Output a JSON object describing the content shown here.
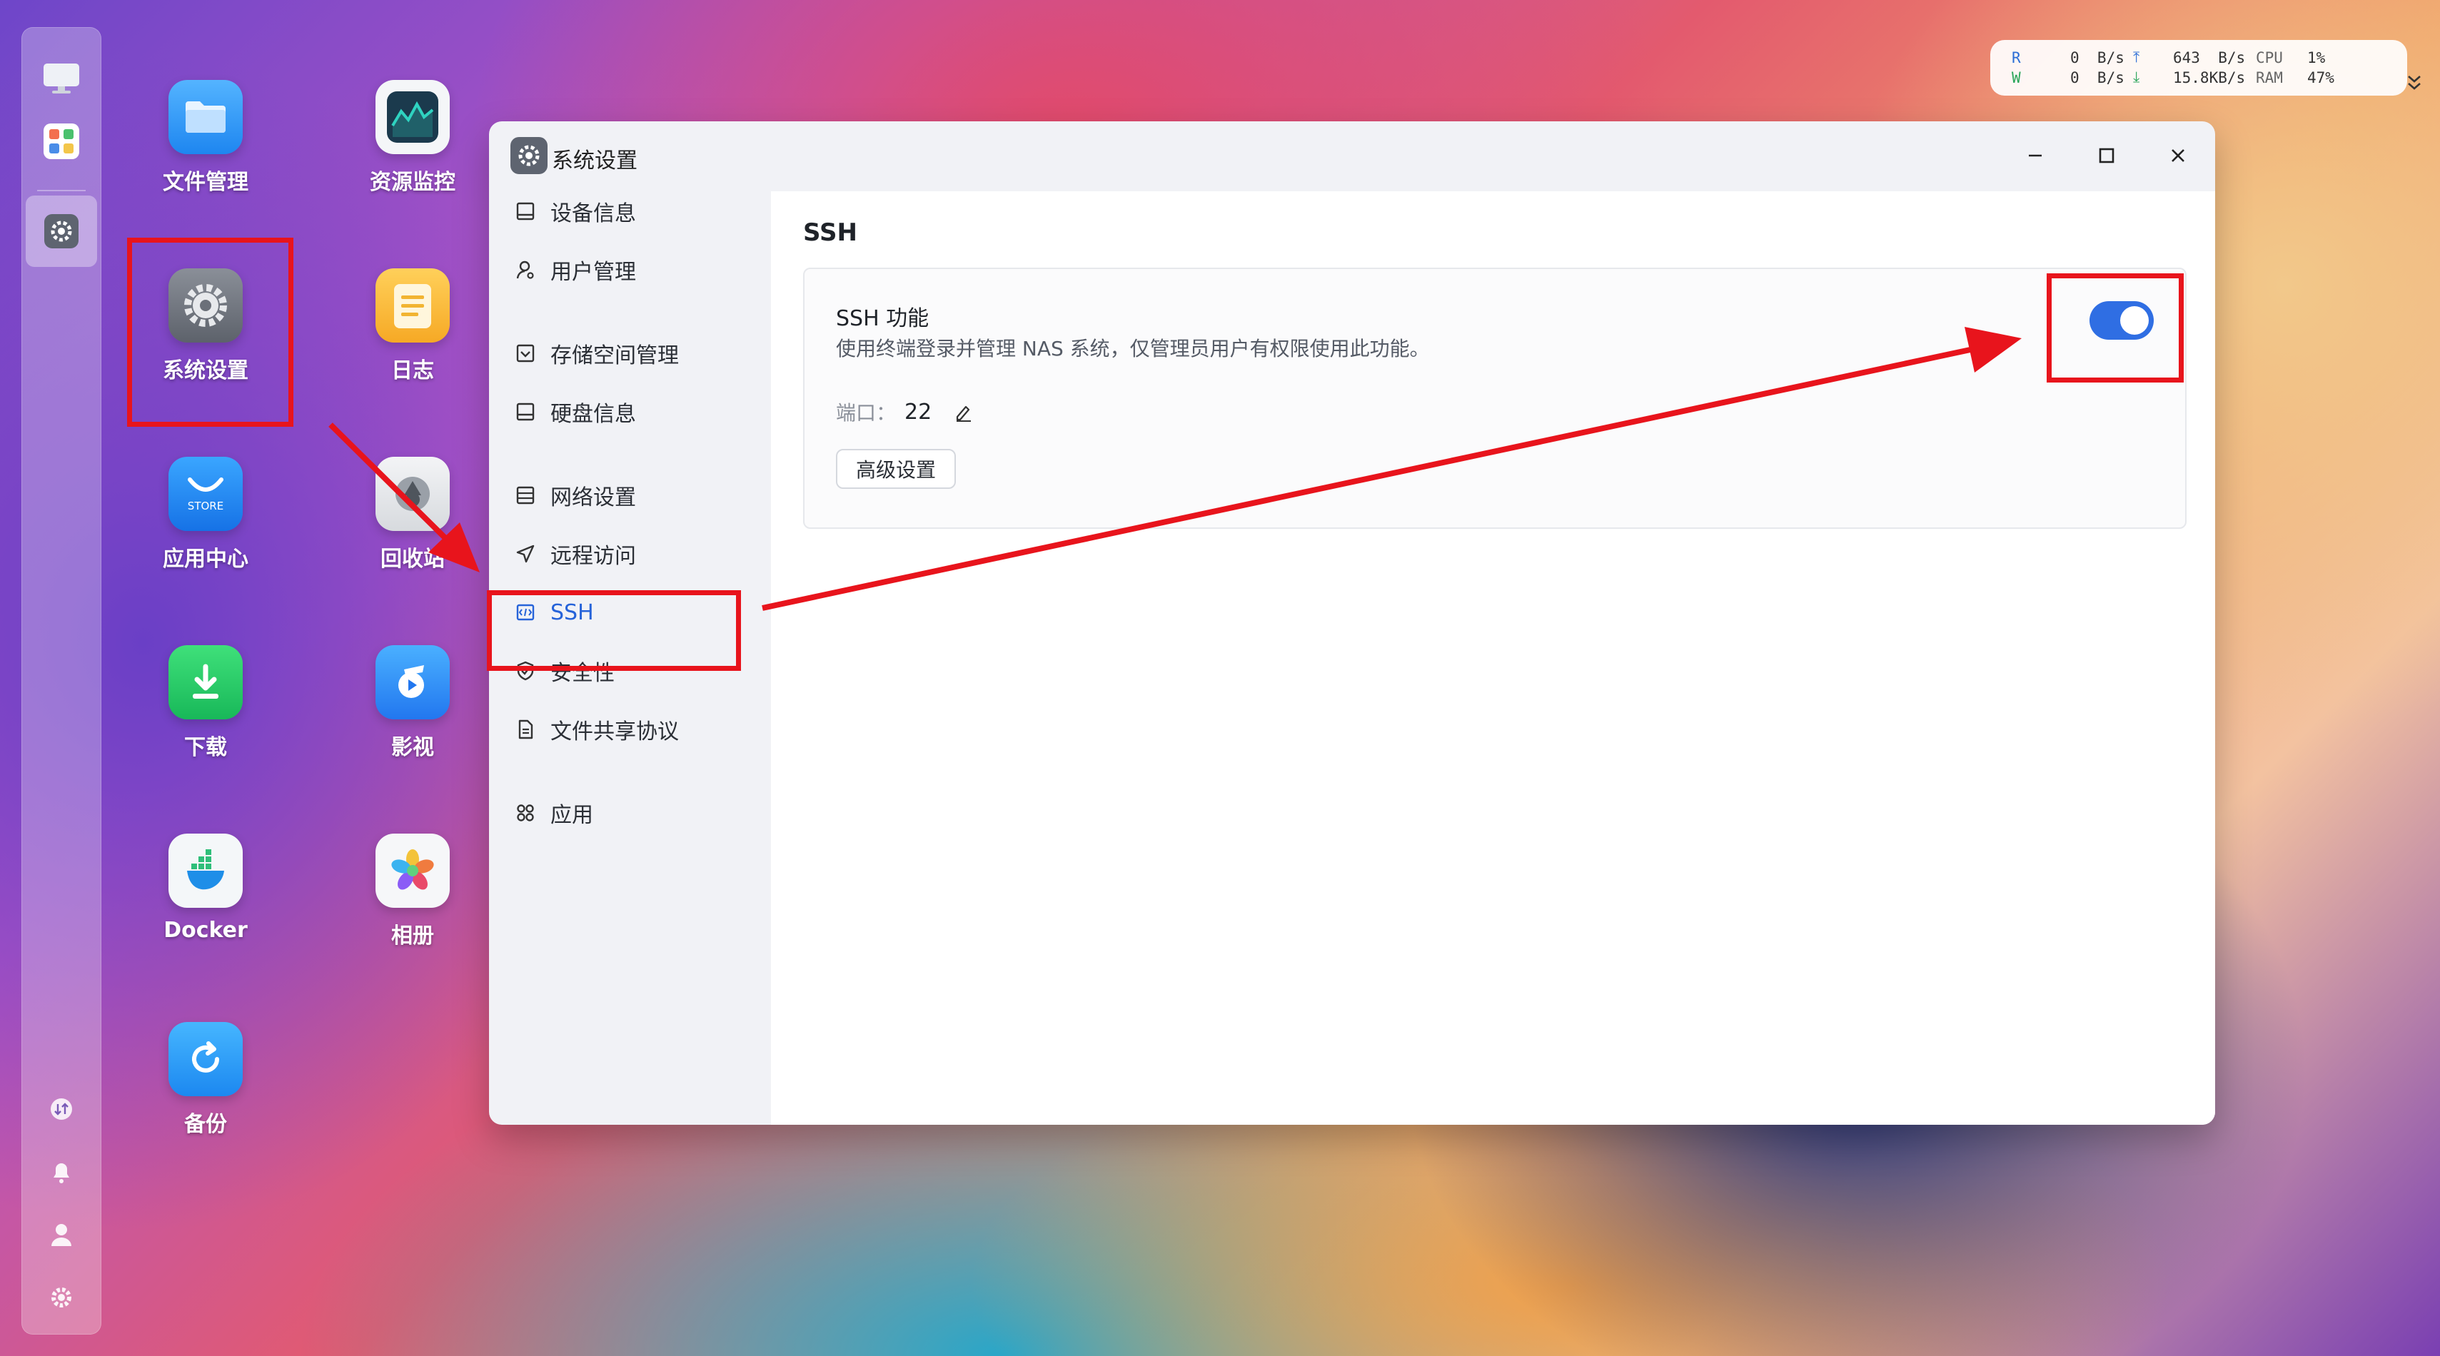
{
  "desktop": {
    "icons": [
      {
        "label": "文件管理"
      },
      {
        "label": "资源监控"
      },
      {
        "label": "系统设置"
      },
      {
        "label": "日志"
      },
      {
        "label": "应用中心",
        "badge": "STORE"
      },
      {
        "label": "回收站"
      },
      {
        "label": "下载"
      },
      {
        "label": "影视"
      },
      {
        "label": "Docker"
      },
      {
        "label": "相册"
      },
      {
        "label": "备份"
      }
    ]
  },
  "status_widget": {
    "r_label": "R",
    "w_label": "W",
    "read_speed": "0  B/s",
    "write_speed": "0  B/s",
    "upload_speed": "643  B/s",
    "download_speed": "15.8KB/s",
    "cpu_label": "CPU",
    "ram_label": "RAM",
    "cpu_value": "1%",
    "ram_value": "47%"
  },
  "window": {
    "title": "系统设置",
    "nav": [
      {
        "label": "设备信息",
        "icon": "monitor-icon"
      },
      {
        "label": "用户管理",
        "icon": "user-icon"
      },
      {
        "label": "存储空间管理",
        "icon": "storage-icon"
      },
      {
        "label": "硬盘信息",
        "icon": "disk-icon"
      },
      {
        "label": "网络设置",
        "icon": "network-icon"
      },
      {
        "label": "远程访问",
        "icon": "send-icon"
      },
      {
        "label": "SSH",
        "icon": "terminal-icon",
        "active": true
      },
      {
        "label": "安全性",
        "icon": "shield-icon"
      },
      {
        "label": "文件共享协议",
        "icon": "file-icon"
      },
      {
        "label": "应用",
        "icon": "apps-icon"
      }
    ],
    "content": {
      "title": "SSH",
      "card_title": "SSH 功能",
      "card_desc": "使用终端登录并管理 NAS 系统，仅管理员用户有权限使用此功能。",
      "port_label": "端口：",
      "port_value": "22",
      "advanced_button": "高级设置",
      "ssh_enabled": true
    }
  },
  "colors": {
    "accent": "#2f6ee3",
    "highlight": "#e8141c"
  }
}
